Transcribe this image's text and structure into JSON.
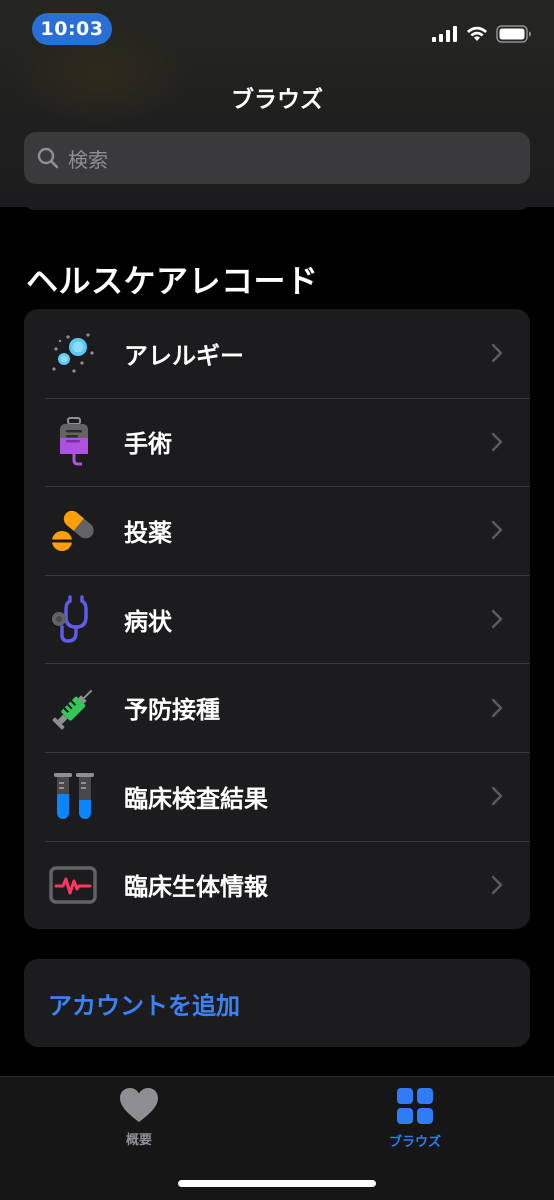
{
  "status_bar": {
    "time": "10:03",
    "time_pill_color": "#2a6fd6",
    "icons": [
      "cellular-signal-icon",
      "wifi-icon",
      "battery-icon"
    ]
  },
  "nav": {
    "title": "ブラウズ"
  },
  "search": {
    "placeholder": "検索",
    "icon": "search-icon"
  },
  "health_records": {
    "section_title": "ヘルスケアレコード",
    "items": [
      {
        "label": "アレルギー",
        "icon": "allergy-pollen-icon"
      },
      {
        "label": "手術",
        "icon": "surgery-iv-bag-icon"
      },
      {
        "label": "投薬",
        "icon": "medication-pills-icon"
      },
      {
        "label": "病状",
        "icon": "condition-stethoscope-icon"
      },
      {
        "label": "予防接種",
        "icon": "vaccine-syringe-icon"
      },
      {
        "label": "臨床検査結果",
        "icon": "lab-test-tubes-icon"
      },
      {
        "label": "臨床生体情報",
        "icon": "vitals-monitor-icon"
      }
    ]
  },
  "add_account": {
    "label": "アカウントを追加",
    "color": "#3a82f7"
  },
  "tabbar": {
    "tabs": [
      {
        "label": "概要",
        "icon": "heart-icon",
        "active": false
      },
      {
        "label": "ブラウズ",
        "icon": "grid-icon",
        "active": true
      }
    ],
    "active_color": "#2f7cf6",
    "inactive_color": "#8e8e93"
  }
}
